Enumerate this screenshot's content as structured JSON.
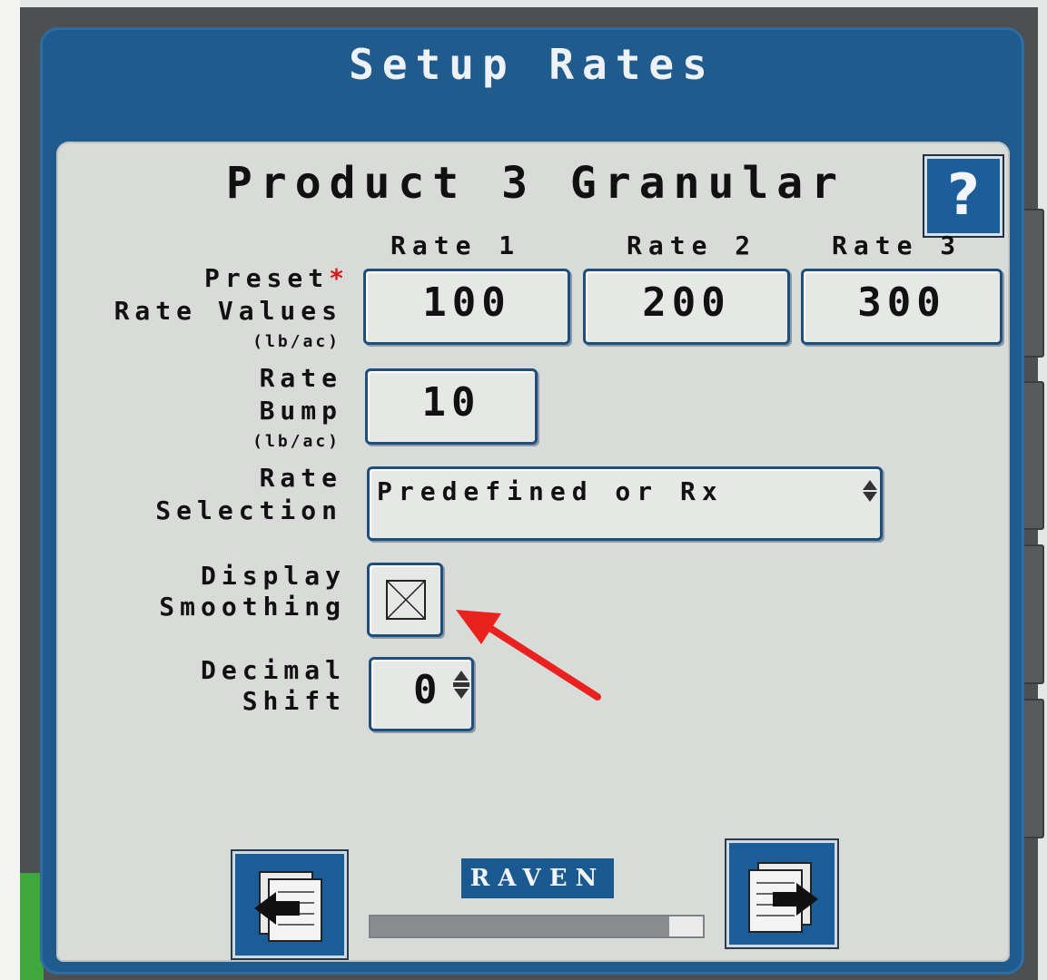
{
  "window": {
    "title": "Setup Rates"
  },
  "panel": {
    "product_title": "Product 3 Granular",
    "help_label": "?"
  },
  "rates": {
    "columns": [
      "Rate 1",
      "Rate 2",
      "Rate 3"
    ],
    "preset_label_1": "Preset",
    "required_mark": "*",
    "preset_label_2": "Rate Values",
    "preset_unit": "(lb/ac)",
    "values": [
      "100",
      "200",
      "300"
    ]
  },
  "rate_bump": {
    "label_1": "Rate",
    "label_2": "Bump",
    "unit": "(lb/ac)",
    "value": "10"
  },
  "rate_selection": {
    "label_1": "Rate",
    "label_2": "Selection",
    "value": "Predefined or Rx"
  },
  "display_smoothing": {
    "label_1": "Display",
    "label_2": "Smoothing",
    "checked": false
  },
  "decimal_shift": {
    "label_1": "Decimal",
    "label_2": "Shift",
    "value": "0"
  },
  "footer": {
    "logo_text": "RAVEN",
    "progress_fraction": 0.9,
    "back_icon": "page-back-icon",
    "next_icon": "page-next-icon"
  },
  "annotation": {
    "icon": "red-arrow-icon",
    "color": "#e8231f"
  },
  "colors": {
    "frame": "#1f5b8c",
    "panel": "#d8dbd8",
    "field_border": "#1d4f7c",
    "required": "#d41a1a"
  }
}
